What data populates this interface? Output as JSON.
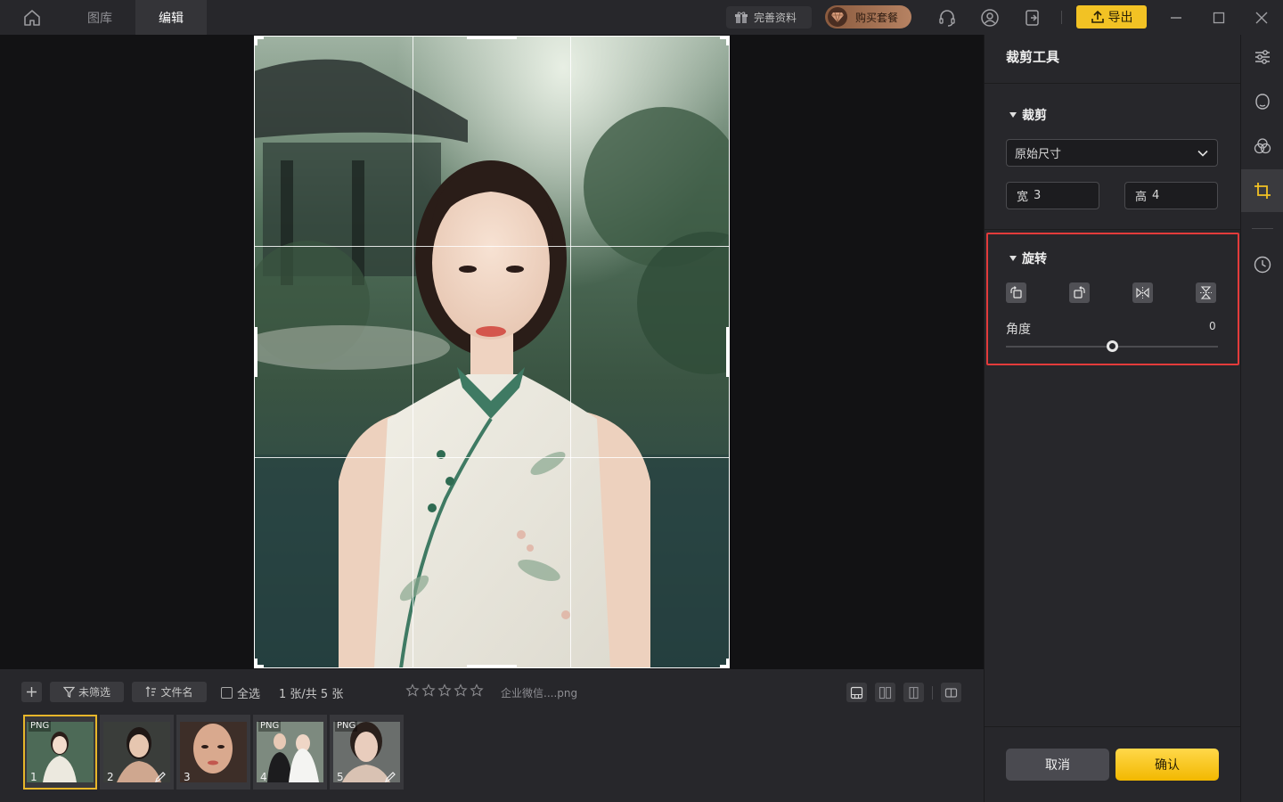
{
  "colors": {
    "accent": "#f2c224",
    "highlight_border": "#e33b3b",
    "active_thumb_border": "#e7b62a",
    "panel_bg": "#27272b",
    "canvas_bg": "#121214"
  },
  "titlebar": {
    "home_icon": "home-icon",
    "tabs": [
      {
        "label": "图库",
        "active": false
      },
      {
        "label": "编辑",
        "active": true
      }
    ],
    "complete_profile_label": "完善资料",
    "buy_package_label": "购买套餐",
    "export_label": "导出",
    "icons": [
      "headset-icon",
      "user-icon",
      "logout-icon",
      "minimize-icon",
      "maximize-icon",
      "close-icon"
    ]
  },
  "bottom_bar": {
    "filter_label": "未筛选",
    "sort_label": "文件名",
    "select_all_label": "全选",
    "count_text": "1 张/共 5 张",
    "rating": 0,
    "rating_max": 5,
    "filename": "企业微信....png",
    "thumbnails": [
      {
        "number": "1",
        "badge": "PNG",
        "edited": false,
        "active": true
      },
      {
        "number": "2",
        "badge": "",
        "edited": true,
        "active": false
      },
      {
        "number": "3",
        "badge": "",
        "edited": false,
        "active": false
      },
      {
        "number": "4",
        "badge": "PNG",
        "edited": false,
        "active": false
      },
      {
        "number": "5",
        "badge": "PNG",
        "edited": true,
        "active": false
      }
    ]
  },
  "panel": {
    "title": "裁剪工具",
    "crop_section": {
      "label": "裁剪",
      "ratio_selected": "原始尺寸",
      "width_label": "宽",
      "width_value": "3",
      "height_label": "高",
      "height_value": "4"
    },
    "rotate_section": {
      "label": "旋转",
      "buttons": [
        "rotate-left-icon",
        "rotate-right-icon",
        "flip-horizontal-icon",
        "flip-vertical-icon"
      ],
      "angle_label": "角度",
      "angle_value": "0",
      "angle_slider_position": 0.5
    },
    "cancel_label": "取消",
    "confirm_label": "确认"
  },
  "tool_strip": {
    "tools": [
      "adjust-sliders-icon",
      "face-retouch-icon",
      "color-filter-icon",
      "crop-icon",
      "history-icon"
    ],
    "active_tool": "crop-icon"
  }
}
